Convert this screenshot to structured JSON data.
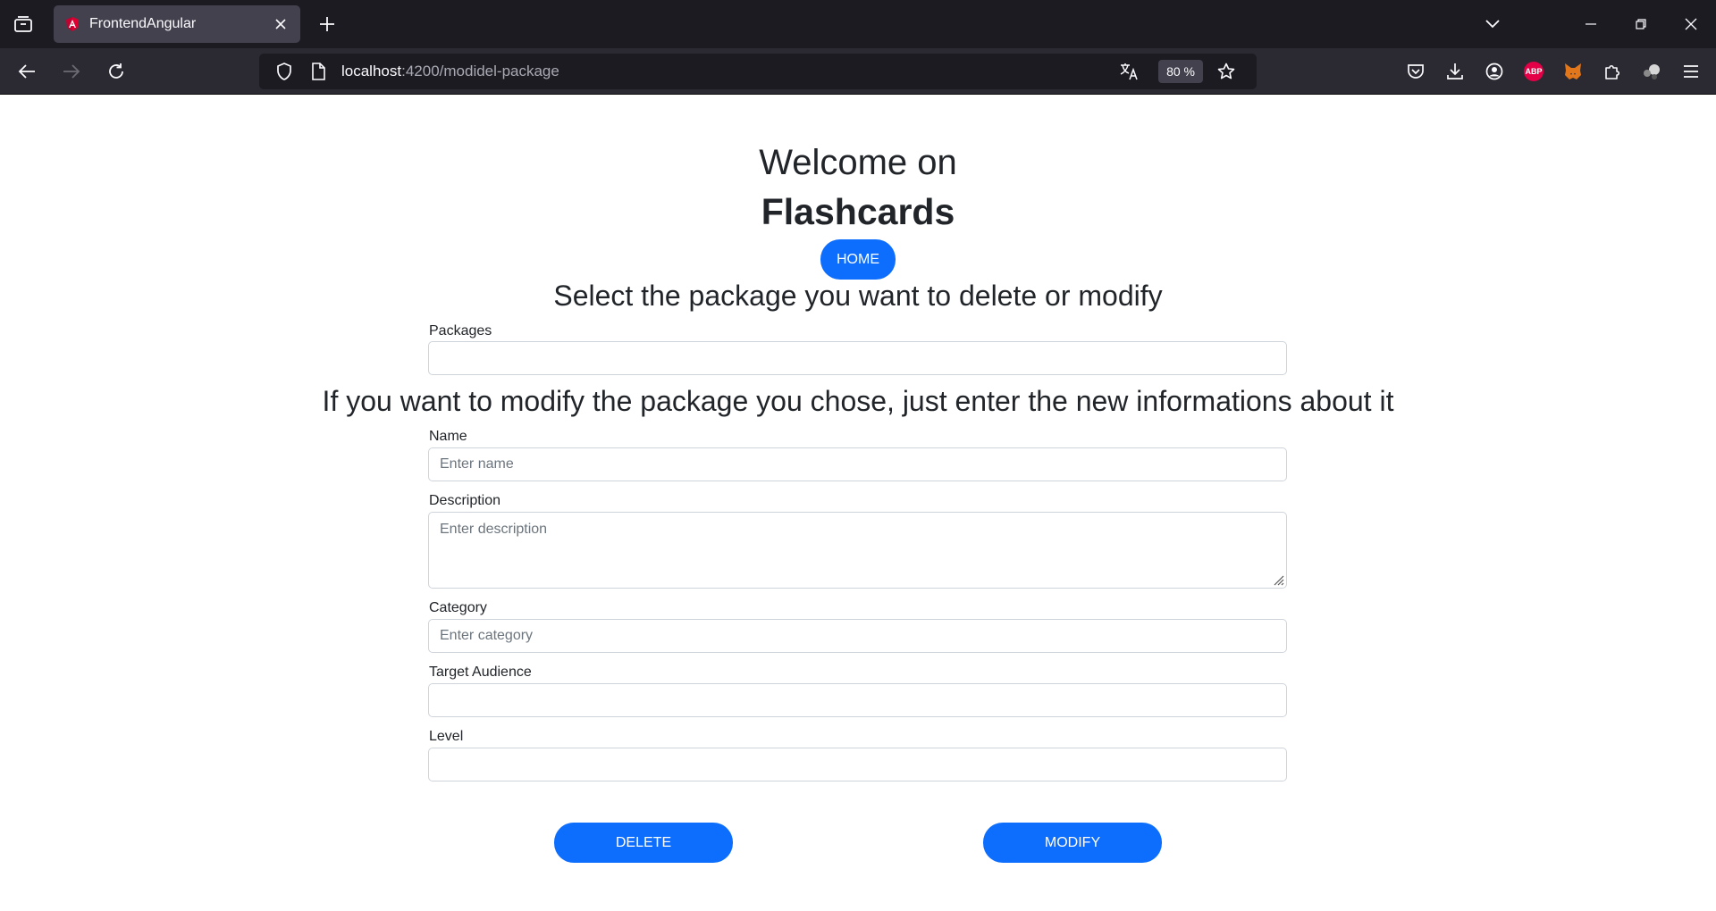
{
  "browser": {
    "tab_title": "FrontendAngular",
    "url_host": "localhost",
    "url_path": ":4200/modidel-package",
    "zoom": "80 %"
  },
  "page": {
    "welcome": "Welcome on",
    "brand": "Flashcards",
    "home_button": "HOME",
    "select_title": "Select the package you want to delete or modify",
    "packages_label": "Packages",
    "packages_value": "",
    "modify_title": "If you want to modify the package you chose, just enter the new informations about it",
    "name_label": "Name",
    "name_placeholder": "Enter name",
    "description_label": "Description",
    "description_placeholder": "Enter description",
    "category_label": "Category",
    "category_placeholder": "Enter category",
    "target_audience_label": "Target Audience",
    "target_audience_value": "",
    "level_label": "Level",
    "level_value": "",
    "delete_button": "DELETE",
    "modify_button": "MODIFY"
  },
  "colors": {
    "primary": "#0d6efd",
    "chrome_dark": "#1c1b22",
    "chrome_toolbar": "#2b2a33"
  }
}
